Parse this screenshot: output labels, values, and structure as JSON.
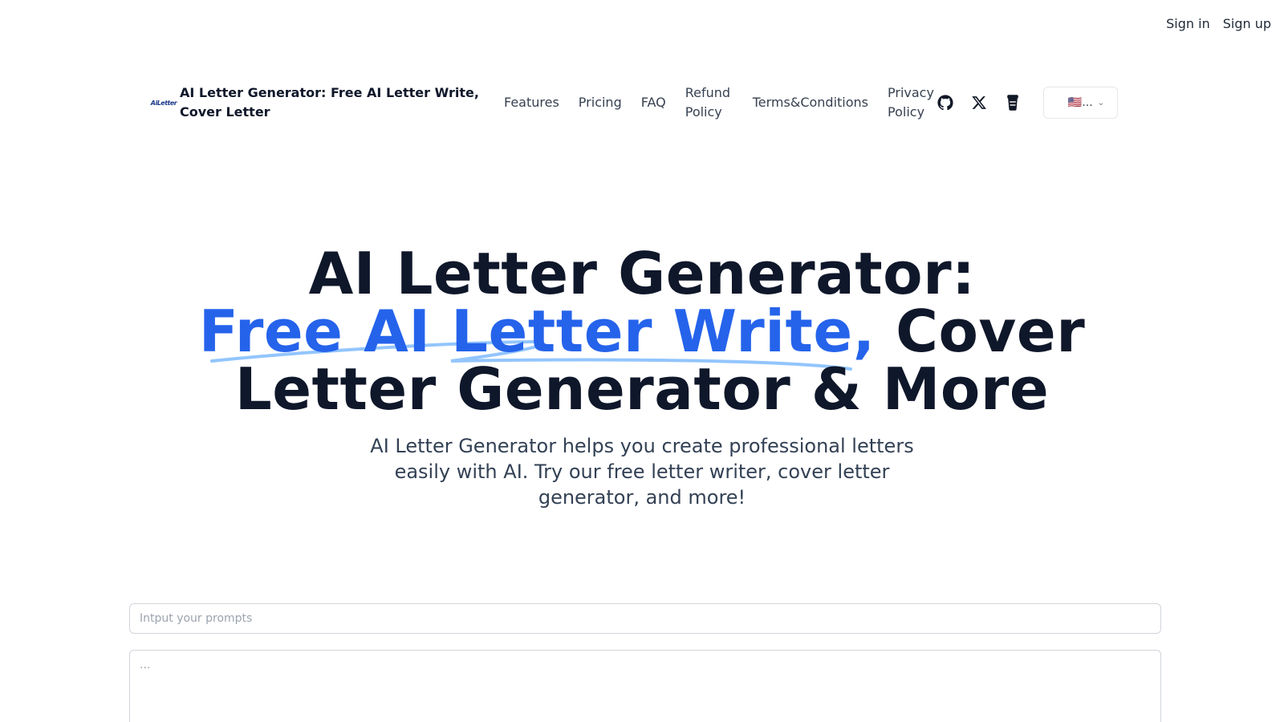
{
  "auth": {
    "sign_in": "Sign in",
    "sign_up": "Sign up"
  },
  "brand": {
    "logo_text": "AiLetter",
    "name": "AI Letter Generator: Free AI Letter Write, Cover Letter"
  },
  "nav": {
    "features": "Features",
    "pricing": "Pricing",
    "faq": "FAQ",
    "refund": "Refund Policy",
    "terms": "Terms&Conditions",
    "privacy": "Privacy Policy"
  },
  "icons": [
    "github-icon",
    "x-twitter-icon",
    "coffee-cup-icon"
  ],
  "language": {
    "selected": "🇺🇸..."
  },
  "hero": {
    "line1": "AI Letter Generator:",
    "line2_accent": "Free AI Letter Write,",
    "line2_rest": " Cover",
    "line3": "Letter Generator & More",
    "subtitle": "AI Letter Generator helps you create professional letters easily with AI. Try our free letter writer, cover letter generator, and more!"
  },
  "prompt": {
    "placeholder": "Intput your prompts"
  },
  "output": {
    "placeholder": "..."
  },
  "colors": {
    "accent": "#2563eb",
    "squiggle": "#93c5fd",
    "heading": "#0f172a"
  }
}
